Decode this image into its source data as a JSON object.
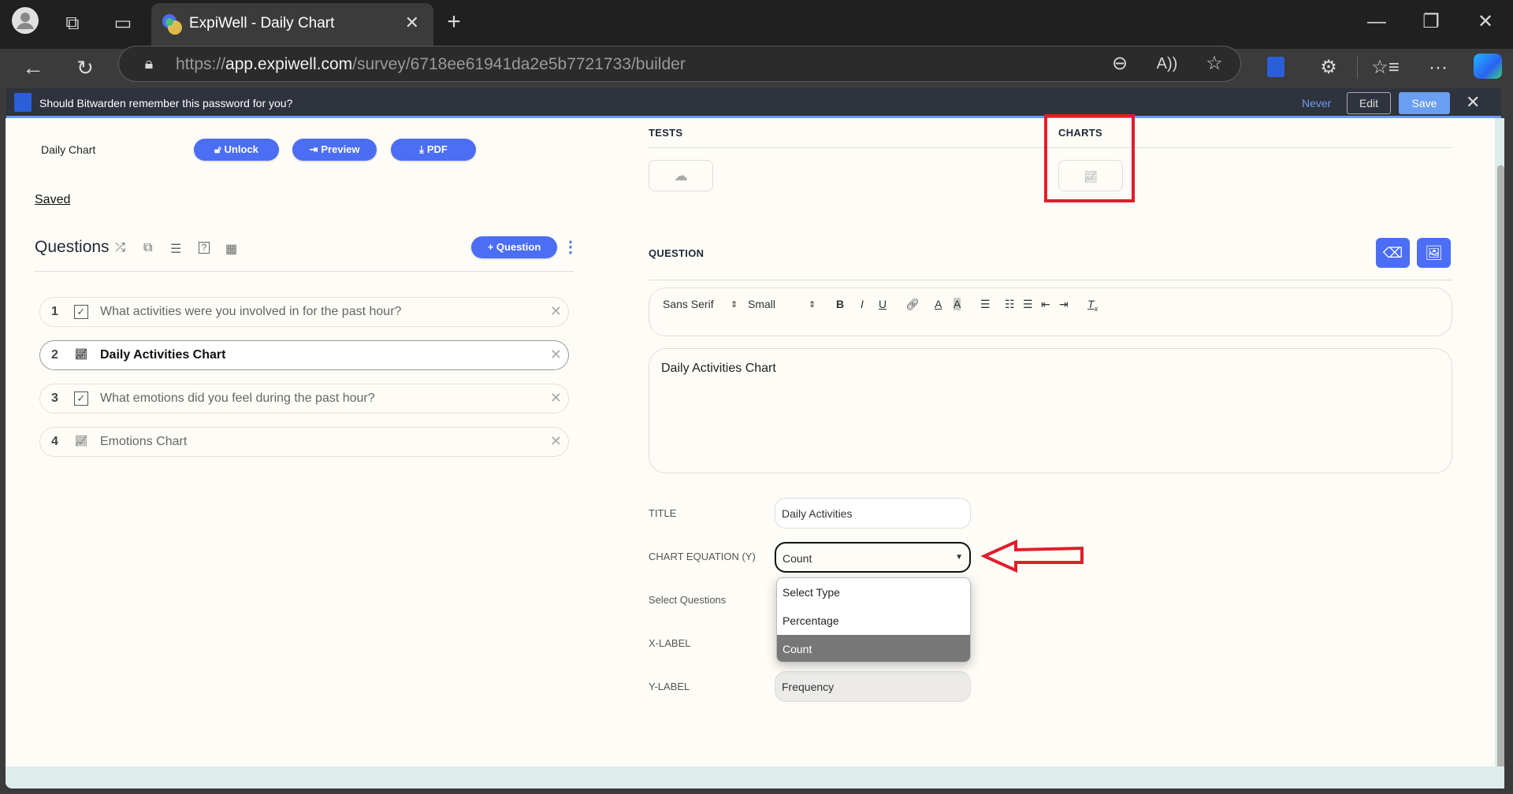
{
  "browser": {
    "tab_title": "ExpiWell - Daily Chart",
    "url_prefix": "https://",
    "url_host": "app.expiwell.com",
    "url_path": "/survey/6718ee61941da2e5b7721733/builder"
  },
  "bitwarden": {
    "message": "Should Bitwarden remember this password for you?",
    "never": "Never",
    "edit": "Edit",
    "save": "Save"
  },
  "survey": {
    "name": "Daily Chart",
    "unlock": "Unlock",
    "preview": "Preview",
    "pdf": "PDF",
    "status": "Saved"
  },
  "questions": {
    "heading": "Questions",
    "add_button": "+ Question",
    "items": [
      {
        "num": "1",
        "type": "checkbox",
        "text": "What activities were you involved in for the past hour?"
      },
      {
        "num": "2",
        "type": "chart",
        "text": "Daily Activities Chart",
        "active": true
      },
      {
        "num": "3",
        "type": "checkbox",
        "text": "What emotions did you feel during the past hour?"
      },
      {
        "num": "4",
        "type": "chart",
        "text": "Emotions Chart"
      }
    ]
  },
  "right": {
    "tests_label": "TESTS",
    "charts_label": "CHARTS",
    "question_label": "QUESTION",
    "toolbar": {
      "font": "Sans Serif",
      "size": "Small"
    },
    "editor_text": "Daily Activities Chart",
    "fields": {
      "title_label": "TITLE",
      "title_value": "Daily Activities",
      "equation_label": "CHART EQUATION (Y)",
      "equation_value": "Count",
      "select_questions_label": "Select Questions",
      "xlabel_label": "X-LABEL",
      "ylabel_label": "Y-LABEL",
      "ylabel_value": "Frequency"
    },
    "dropdown_options": [
      "Select Type",
      "Percentage",
      "Count"
    ],
    "dropdown_selected": "Count"
  },
  "colors": {
    "accent": "#4b6ef5",
    "annotation": "#e11d2a"
  }
}
